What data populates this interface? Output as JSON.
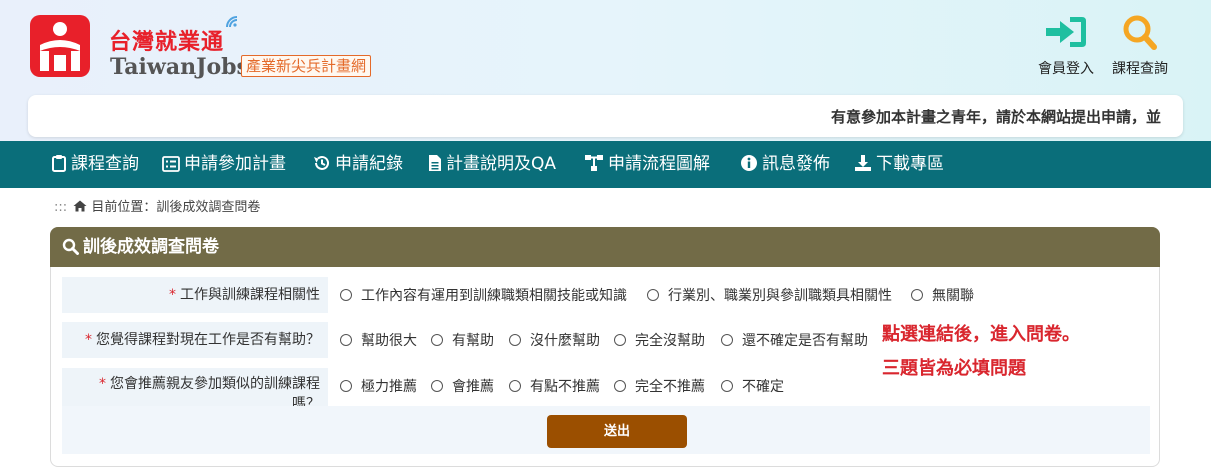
{
  "header": {
    "brand_cn": "台灣就業通",
    "brand_en": "TaiwanJobs",
    "brand_sub": "產業新尖兵計畫網",
    "login_label": "會員登入",
    "course_search_label": "課程查詢",
    "marquee_text": "有意參加本計畫之青年，請於本網站提出申請，並",
    "brand_color": "#e8202a",
    "accent_teal": "#1fbfa0",
    "accent_orange": "#f5a623"
  },
  "nav": {
    "items": [
      {
        "label": "課程查詢",
        "icon": "clipboard-icon"
      },
      {
        "label": "申請參加計畫",
        "icon": "list-icon"
      },
      {
        "label": "申請紀錄",
        "icon": "history-icon"
      },
      {
        "label": "計畫說明及QA",
        "icon": "document-icon"
      },
      {
        "label": "申請流程圖解",
        "icon": "flowchart-icon"
      },
      {
        "label": "訊息發佈",
        "icon": "info-icon"
      },
      {
        "label": "下載專區",
        "icon": "download-icon"
      }
    ],
    "bg_color": "#0a6e7a"
  },
  "breadcrumb": {
    "dots": ":::",
    "text": "目前位置：訓後成效調查問卷"
  },
  "panel": {
    "title": "訓後成效調查問卷",
    "header_color": "#726b47",
    "questions": [
      {
        "required": "*",
        "label": "工作與訓練課程相關性",
        "options": [
          "工作內容有運用到訓練職類相關技能或知識",
          "行業別、職業別與參訓職類具相關性",
          "無關聯"
        ]
      },
      {
        "required": "*",
        "label": "您覺得課程對現在工作是否有幫助？",
        "options": [
          "幫助很大",
          "有幫助",
          "沒什麼幫助",
          "完全沒幫助",
          "還不確定是否有幫助"
        ]
      },
      {
        "required": "*",
        "label_line1": "您會推薦親友參加類似的訓練課程",
        "label_line2": "嗎？",
        "options": [
          "極力推薦",
          "會推薦",
          "有點不推薦",
          "完全不推薦",
          "不確定"
        ]
      }
    ],
    "submit_label": "送出",
    "submit_color": "#9b4f00"
  },
  "annotation": {
    "line1": "點選連結後，進入問卷。",
    "line2": "三題皆為必填問題",
    "color": "#d9262e"
  }
}
